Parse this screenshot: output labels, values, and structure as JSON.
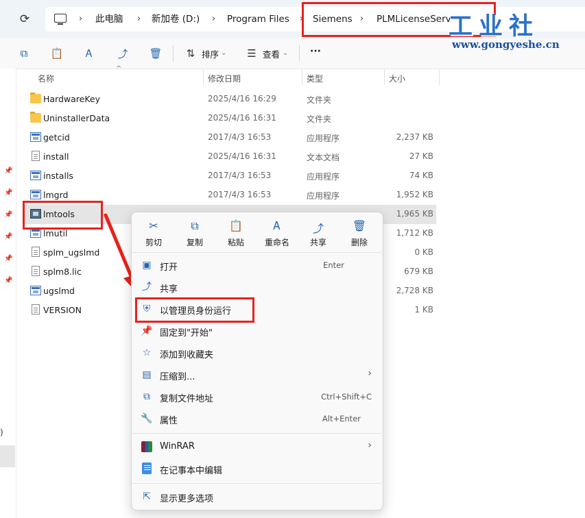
{
  "address": {
    "refresh_icon": "refresh-icon",
    "breadcrumbs": [
      "此电脑",
      "新加卷 (D:)",
      "Program Files",
      "Siemens",
      "PLMLicenseServ"
    ]
  },
  "watermark": {
    "title": "工业社",
    "url": "www.gongyeshe.cn"
  },
  "toolbar": {
    "sort_label": "排序",
    "view_label": "查看",
    "more_label": "···"
  },
  "left_nav": {
    "stray_char": ")"
  },
  "columns": {
    "name": "名称",
    "date": "修改日期",
    "type": "类型",
    "size": "大小"
  },
  "files": [
    {
      "name": "HardwareKey",
      "date": "2025/4/16 16:29",
      "type": "文件夹",
      "size": "",
      "icon": "folder"
    },
    {
      "name": "UninstallerData",
      "date": "2025/4/16 16:31",
      "type": "文件夹",
      "size": "",
      "icon": "folder"
    },
    {
      "name": "getcid",
      "date": "2017/4/3 16:53",
      "type": "应用程序",
      "size": "2,237 KB",
      "icon": "exe"
    },
    {
      "name": "install",
      "date": "2025/4/16 16:31",
      "type": "文本文档",
      "size": "27 KB",
      "icon": "doc"
    },
    {
      "name": "installs",
      "date": "2017/4/3 16:53",
      "type": "应用程序",
      "size": "74 KB",
      "icon": "exe"
    },
    {
      "name": "lmgrd",
      "date": "2017/4/3 16:53",
      "type": "应用程序",
      "size": "1,952 KB",
      "icon": "exe"
    },
    {
      "name": "lmtools",
      "date": "",
      "type": "",
      "size": "1,965 KB",
      "icon": "lm"
    },
    {
      "name": "lmutil",
      "date": "",
      "type": "",
      "size": "1,712 KB",
      "icon": "exe"
    },
    {
      "name": "splm_ugslmd",
      "date": "",
      "type": "",
      "size": "0 KB",
      "icon": "doc"
    },
    {
      "name": "splm8.lic",
      "date": "",
      "type": "",
      "size": "679 KB",
      "icon": "doc"
    },
    {
      "name": "ugslmd",
      "date": "",
      "type": "",
      "size": "2,728 KB",
      "icon": "exe"
    },
    {
      "name": "VERSION",
      "date": "",
      "type": "",
      "size": "1 KB",
      "icon": "doc"
    }
  ],
  "context_menu": {
    "quick": [
      {
        "label": "剪切",
        "icon": "cut-icon"
      },
      {
        "label": "复制",
        "icon": "copy-icon"
      },
      {
        "label": "粘贴",
        "icon": "paste-icon"
      },
      {
        "label": "重命名",
        "icon": "rename-icon"
      },
      {
        "label": "共享",
        "icon": "share-icon"
      },
      {
        "label": "删除",
        "icon": "delete-icon"
      }
    ],
    "open": {
      "label": "打开",
      "shortcut": "Enter"
    },
    "share": {
      "label": "共享"
    },
    "run_as_admin": {
      "label": "以管理员身份运行"
    },
    "pin_start": {
      "label": "固定到\"开始\""
    },
    "add_favorites": {
      "label": "添加到收藏夹"
    },
    "compress": {
      "label": "压缩到..."
    },
    "copy_path": {
      "label": "复制文件地址",
      "shortcut": "Ctrl+Shift+C"
    },
    "properties": {
      "label": "属性",
      "shortcut": "Alt+Enter"
    },
    "winrar": {
      "label": "WinRAR"
    },
    "notepad": {
      "label": "在记事本中编辑"
    },
    "more_options": {
      "label": "显示更多选项"
    }
  },
  "colors": {
    "highlight_red": "#e8211d",
    "accent_blue": "#2566b0",
    "watermark_blue": "#2a72c8"
  }
}
